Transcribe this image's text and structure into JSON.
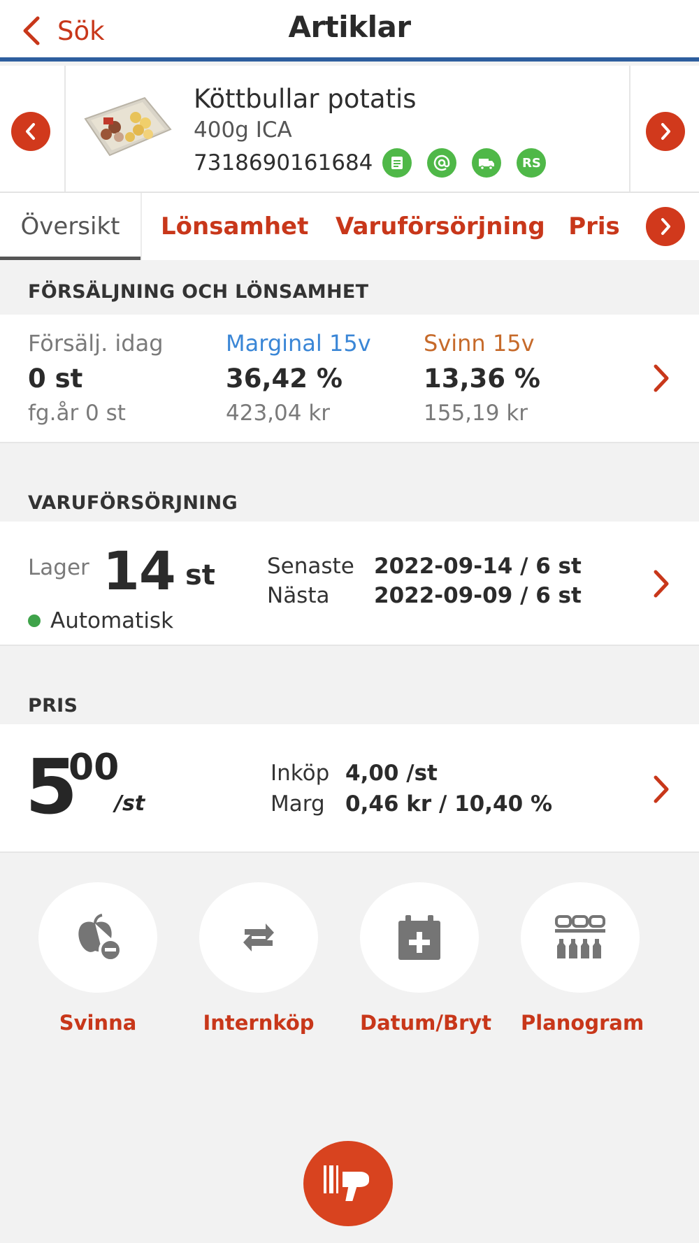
{
  "header": {
    "back_label": "Sök",
    "title": "Artiklar"
  },
  "product": {
    "name": "Köttbullar potatis",
    "details": "400g ICA",
    "ean": "7318690161684",
    "badges": [
      "receipt-icon",
      "at-icon",
      "truck-icon",
      "RS"
    ]
  },
  "tabs": [
    {
      "label": "Översikt",
      "active": true
    },
    {
      "label": "Lönsamhet"
    },
    {
      "label": "Varuförsörjning"
    },
    {
      "label": "Pris"
    }
  ],
  "sales": {
    "heading": "FÖRSÄLJNING OCH LÖNSAMHET",
    "today": {
      "label": "Försälj. idag",
      "value": "0 st",
      "sub": "fg.år 0 st"
    },
    "margin": {
      "label": "Marginal 15v",
      "value": "36,42 %",
      "sub": "423,04 kr",
      "color": "#3a86d6"
    },
    "waste": {
      "label": "Svinn 15v",
      "value": "13,36 %",
      "sub": "155,19 kr",
      "color": "#c66a2a"
    }
  },
  "supply": {
    "heading": "VARUFÖRSÖRJNING",
    "stock_label": "Lager",
    "stock_value": "14",
    "stock_unit": "st",
    "mode": "Automatisk",
    "latest_label": "Senaste",
    "latest_value": "2022-09-14 / 6 st",
    "next_label": "Nästa",
    "next_value": "2022-09-09 / 6 st"
  },
  "price": {
    "heading": "PRIS",
    "integer": "5",
    "decimals": "00",
    "unit": "/st",
    "purchase_label": "Inköp",
    "purchase_value": "4,00 /st",
    "margin_label": "Marg",
    "margin_value": "0,46 kr / 10,40 %"
  },
  "actions": [
    {
      "label": "Svinna",
      "icon": "apple-minus-icon"
    },
    {
      "label": "Internköp",
      "icon": "swap-icon"
    },
    {
      "label": "Datum/Bryt",
      "icon": "calendar-plus-icon"
    },
    {
      "label": "Planogram",
      "icon": "shelf-icon"
    }
  ],
  "colors": {
    "accent": "#c8371a",
    "header_border": "#2d5e9e",
    "badge": "#4fb848",
    "status": "#3fa34a"
  }
}
